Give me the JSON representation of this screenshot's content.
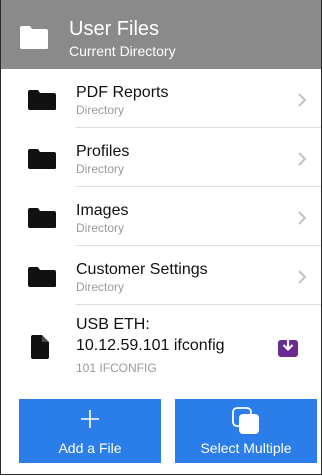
{
  "header": {
    "title": "User Files",
    "subtitle": "Current Directory",
    "icon": "folder-icon"
  },
  "items": [
    {
      "title": "PDF Reports",
      "subtitle": "Directory",
      "icon": "folder-icon"
    },
    {
      "title": "Profiles",
      "subtitle": "Directory",
      "icon": "folder-icon"
    },
    {
      "title": "Images",
      "subtitle": "Directory",
      "icon": "folder-icon"
    },
    {
      "title": "Customer Settings",
      "subtitle": "Directory",
      "icon": "folder-icon"
    }
  ],
  "file": {
    "title_line1": "USB ETH:",
    "title_line2": "10.12.59.101 ifconfig",
    "subtitle": "101 IFCONFIG",
    "icon": "file-icon",
    "action_icon": "download-icon",
    "action_color": "#6a2c91"
  },
  "buttons": {
    "add_label": "Add a File",
    "add_icon": "plus-icon",
    "multi_label": "Select Multiple",
    "multi_icon": "select-multiple-icon"
  },
  "colors": {
    "header_bg": "#8a8a8a",
    "button_bg": "#2b7de9",
    "divider": "#dedede",
    "subtitle": "#9a9a9a"
  }
}
